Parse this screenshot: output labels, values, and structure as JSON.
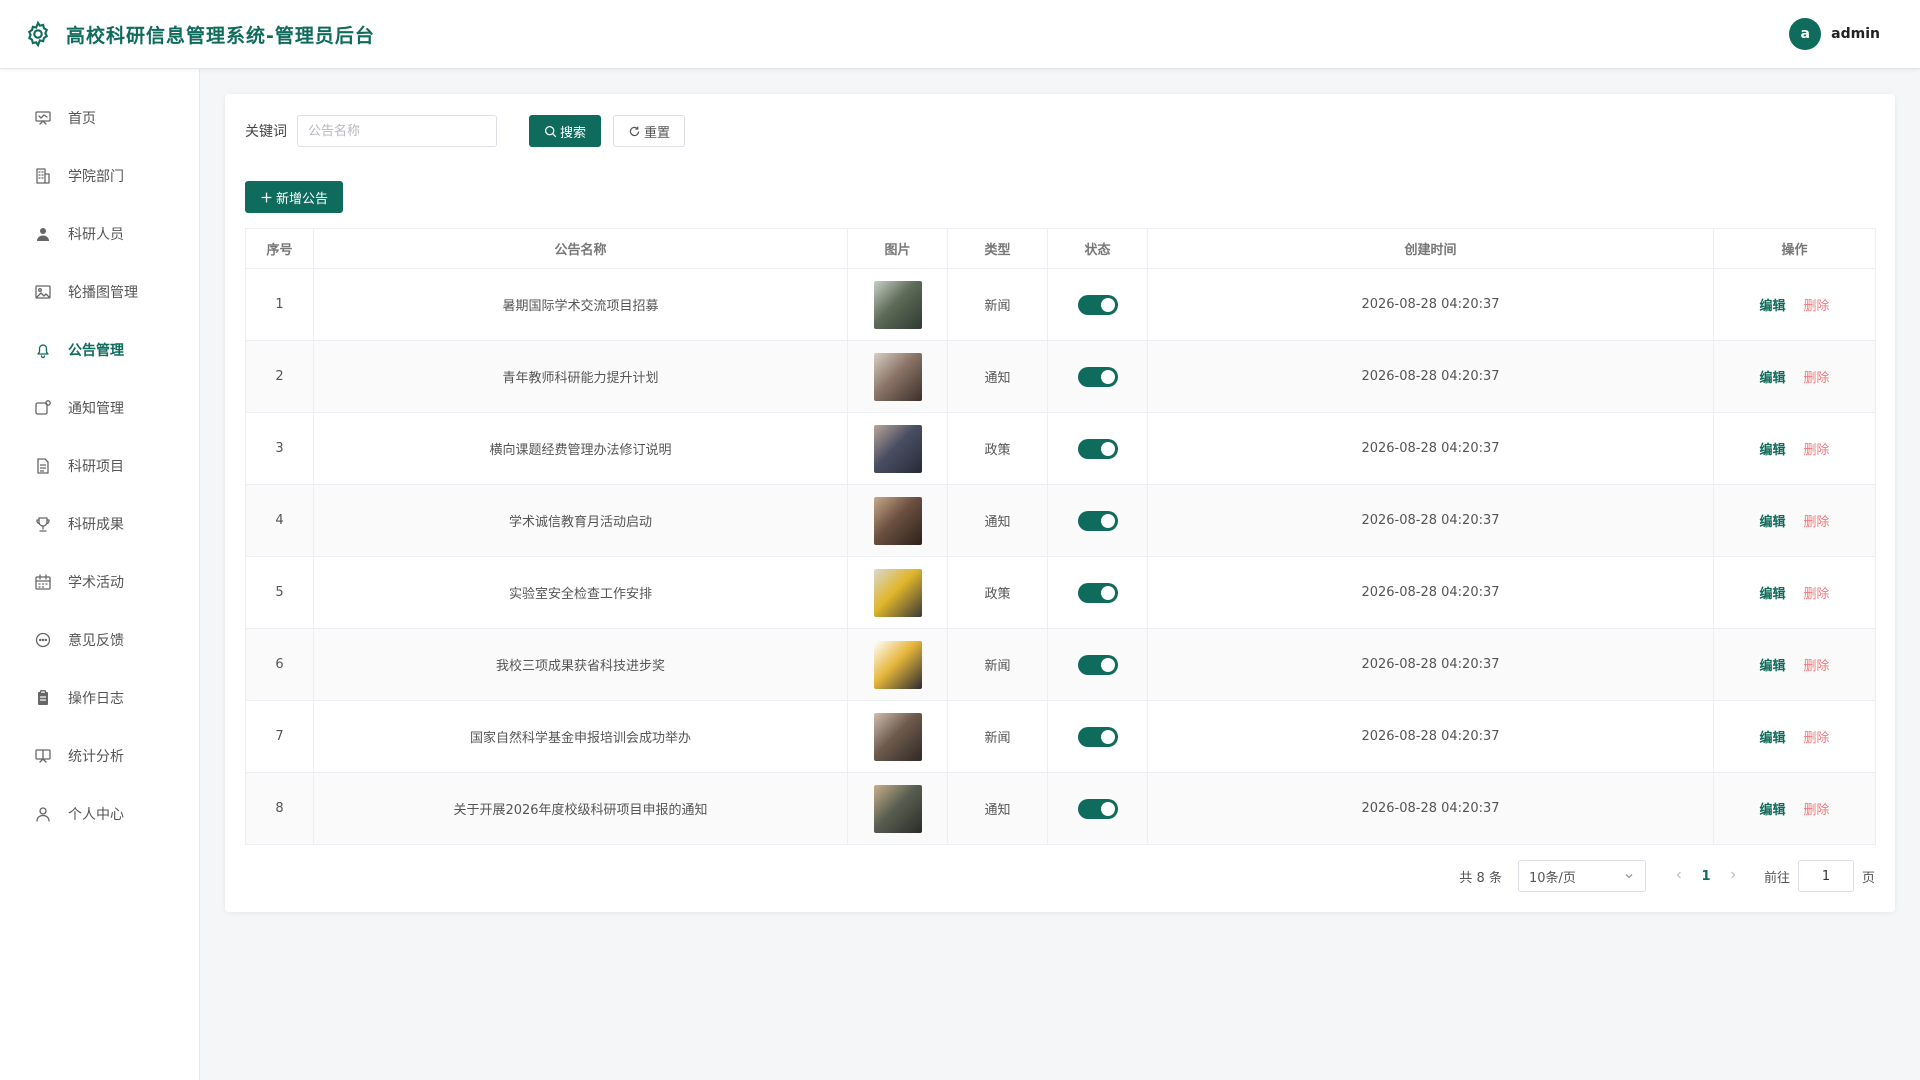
{
  "header": {
    "title": "高校科研信息管理系统-管理员后台",
    "user": {
      "avatar_letter": "a",
      "name": "admin"
    }
  },
  "sidebar": {
    "items": [
      {
        "label": "首页",
        "icon": "presentation-icon",
        "active": false
      },
      {
        "label": "学院部门",
        "icon": "building-icon",
        "active": false
      },
      {
        "label": "科研人员",
        "icon": "user-icon",
        "active": false
      },
      {
        "label": "轮播图管理",
        "icon": "picture-icon",
        "active": false
      },
      {
        "label": "公告管理",
        "icon": "bell-icon",
        "active": true
      },
      {
        "label": "通知管理",
        "icon": "message-icon",
        "active": false
      },
      {
        "label": "科研项目",
        "icon": "document-icon",
        "active": false
      },
      {
        "label": "科研成果",
        "icon": "trophy-icon",
        "active": false
      },
      {
        "label": "学术活动",
        "icon": "calendar-icon",
        "active": false
      },
      {
        "label": "意见反馈",
        "icon": "chat-icon",
        "active": false
      },
      {
        "label": "操作日志",
        "icon": "clipboard-icon",
        "active": false
      },
      {
        "label": "统计分析",
        "icon": "data-board-icon",
        "active": false
      },
      {
        "label": "个人中心",
        "icon": "person-icon",
        "active": false
      }
    ]
  },
  "search": {
    "label": "关键词",
    "placeholder": "公告名称",
    "value": "",
    "search_label": "搜索",
    "reset_label": "重置"
  },
  "actions": {
    "add_label": "新增公告"
  },
  "table": {
    "columns": [
      "序号",
      "公告名称",
      "图片",
      "类型",
      "状态",
      "创建时间",
      "操作"
    ],
    "rows": [
      {
        "no": "1",
        "title": "暑期国际学术交流项目招募",
        "type": "新闻",
        "status": true,
        "created": "2026-08-28 04:20:37",
        "thumb": [
          "#5d6b57",
          "#c8cfc6",
          "#2e3a33"
        ]
      },
      {
        "no": "2",
        "title": "青年教师科研能力提升计划",
        "type": "通知",
        "status": true,
        "created": "2026-08-28 04:20:37",
        "thumb": [
          "#8a7467",
          "#d9cfc6",
          "#3b2f2a"
        ]
      },
      {
        "no": "3",
        "title": "横向课题经费管理办法修订说明",
        "type": "政策",
        "status": true,
        "created": "2026-08-28 04:20:37",
        "thumb": [
          "#4a4e63",
          "#b9a59a",
          "#272a36"
        ]
      },
      {
        "no": "4",
        "title": "学术诚信教育月活动启动",
        "type": "通知",
        "status": true,
        "created": "2026-08-28 04:20:37",
        "thumb": [
          "#6b5040",
          "#c9a98a",
          "#2c211b"
        ]
      },
      {
        "no": "5",
        "title": "实验室安全检查工作安排",
        "type": "政策",
        "status": true,
        "created": "2026-08-28 04:20:37",
        "thumb": [
          "#e0b62a",
          "#d8d8d0",
          "#3a3a3a"
        ]
      },
      {
        "no": "6",
        "title": "我校三项成果获省科技进步奖",
        "type": "新闻",
        "status": true,
        "created": "2026-08-28 04:20:37",
        "thumb": [
          "#e6b63a",
          "#ffffff",
          "#2b2b30"
        ]
      },
      {
        "no": "7",
        "title": "国家自然科学基金申报培训会成功举办",
        "type": "新闻",
        "status": true,
        "created": "2026-08-28 04:20:37",
        "thumb": [
          "#6e5a4c",
          "#cdbfb2",
          "#2f2925"
        ]
      },
      {
        "no": "8",
        "title": "关于开展2026年度校级科研项目申报的通知",
        "type": "通知",
        "status": true,
        "created": "2026-08-28 04:20:37",
        "thumb": [
          "#5a5f52",
          "#c9b08a",
          "#2a2b27"
        ]
      }
    ],
    "edit_label": "编辑",
    "delete_label": "删除"
  },
  "pagination": {
    "total": "共 8 条",
    "page_size": "10条/页",
    "current_page": "1",
    "goto_label": "前往",
    "goto_value": "1",
    "goto_suffix": "页"
  },
  "colors": {
    "primary": "#0f6b5c",
    "danger": "#f07a7a"
  }
}
